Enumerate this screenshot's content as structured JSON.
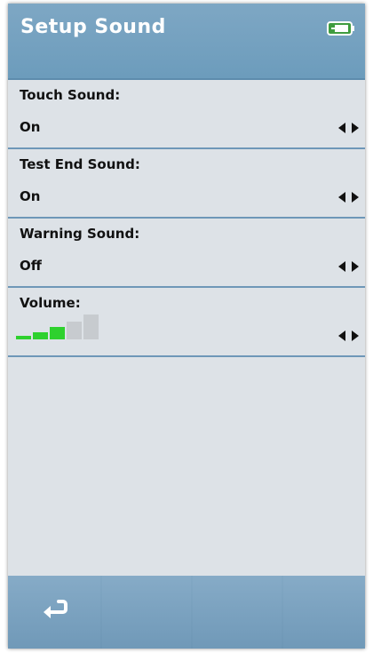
{
  "header": {
    "title": "Setup Sound",
    "battery_icon": "battery-charging-icon"
  },
  "settings": [
    {
      "label": "Touch Sound:",
      "value": "On"
    },
    {
      "label": "Test End Sound:",
      "value": "On"
    },
    {
      "label": "Warning Sound:",
      "value": "Off"
    },
    {
      "label": "Volume:",
      "level_of_5": 3
    }
  ],
  "footer": {
    "buttons": [
      {
        "icon": "back-icon"
      },
      {
        "icon": ""
      },
      {
        "icon": ""
      },
      {
        "icon": ""
      }
    ]
  },
  "colors": {
    "header": "#7ea7c4",
    "background": "#dde2e7",
    "volume_active": "#2ed12e",
    "volume_inactive": "#c7cbcf"
  }
}
